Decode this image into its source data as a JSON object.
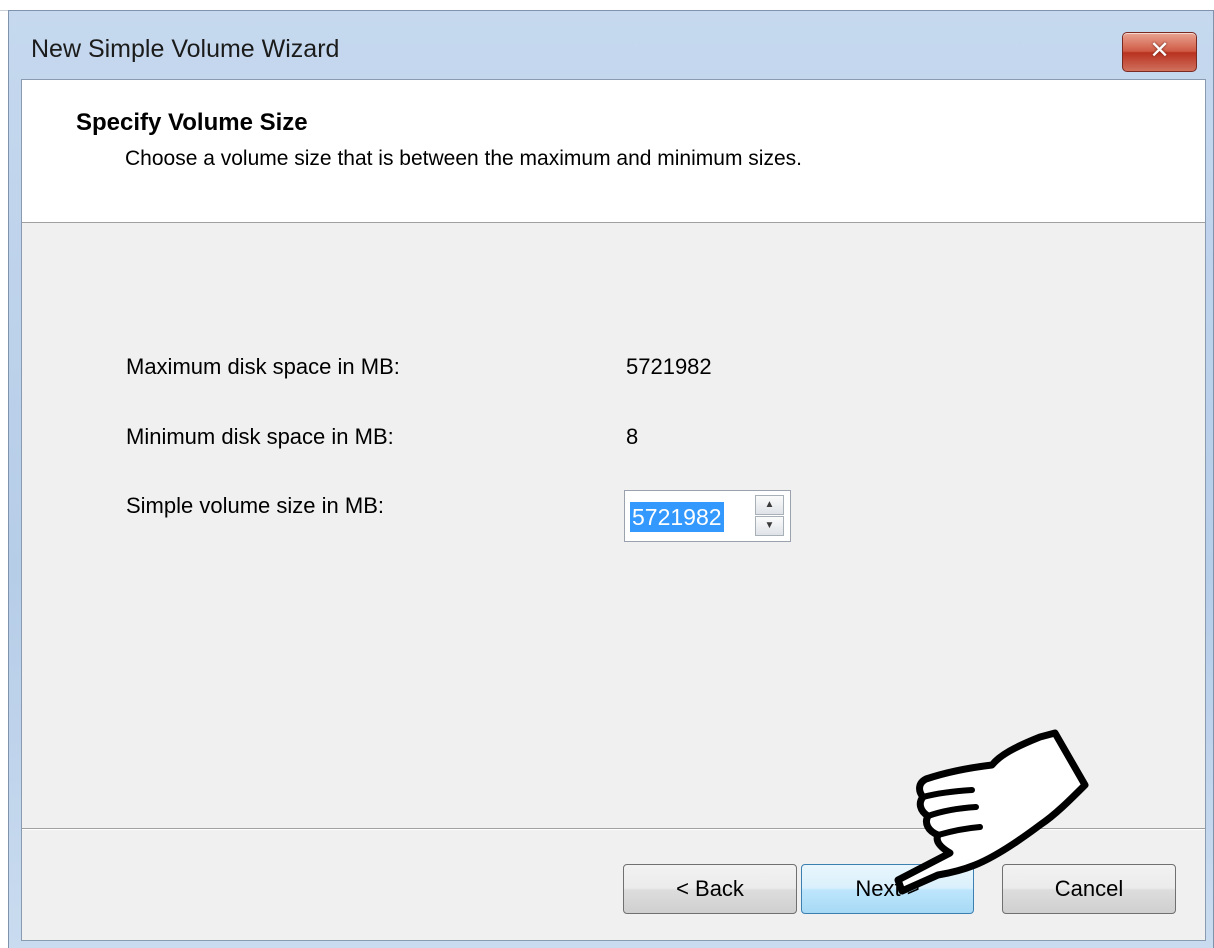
{
  "window": {
    "title": "New Simple Volume Wizard",
    "close_label": "✕"
  },
  "header": {
    "title": "Specify Volume Size",
    "subtitle": "Choose a volume size that is between the maximum and minimum sizes."
  },
  "fields": {
    "max_label": "Maximum disk space in MB:",
    "max_value": "5721982",
    "min_label": "Minimum disk space in MB:",
    "min_value": "8",
    "size_label": "Simple volume size in MB:",
    "size_value": "5721982"
  },
  "spinner": {
    "up": "▲",
    "down": "▼"
  },
  "buttons": {
    "back": "< Back",
    "next": "Next >",
    "cancel": "Cancel"
  },
  "colors": {
    "selection": "#3399ff",
    "close_button": "#c9452f"
  }
}
